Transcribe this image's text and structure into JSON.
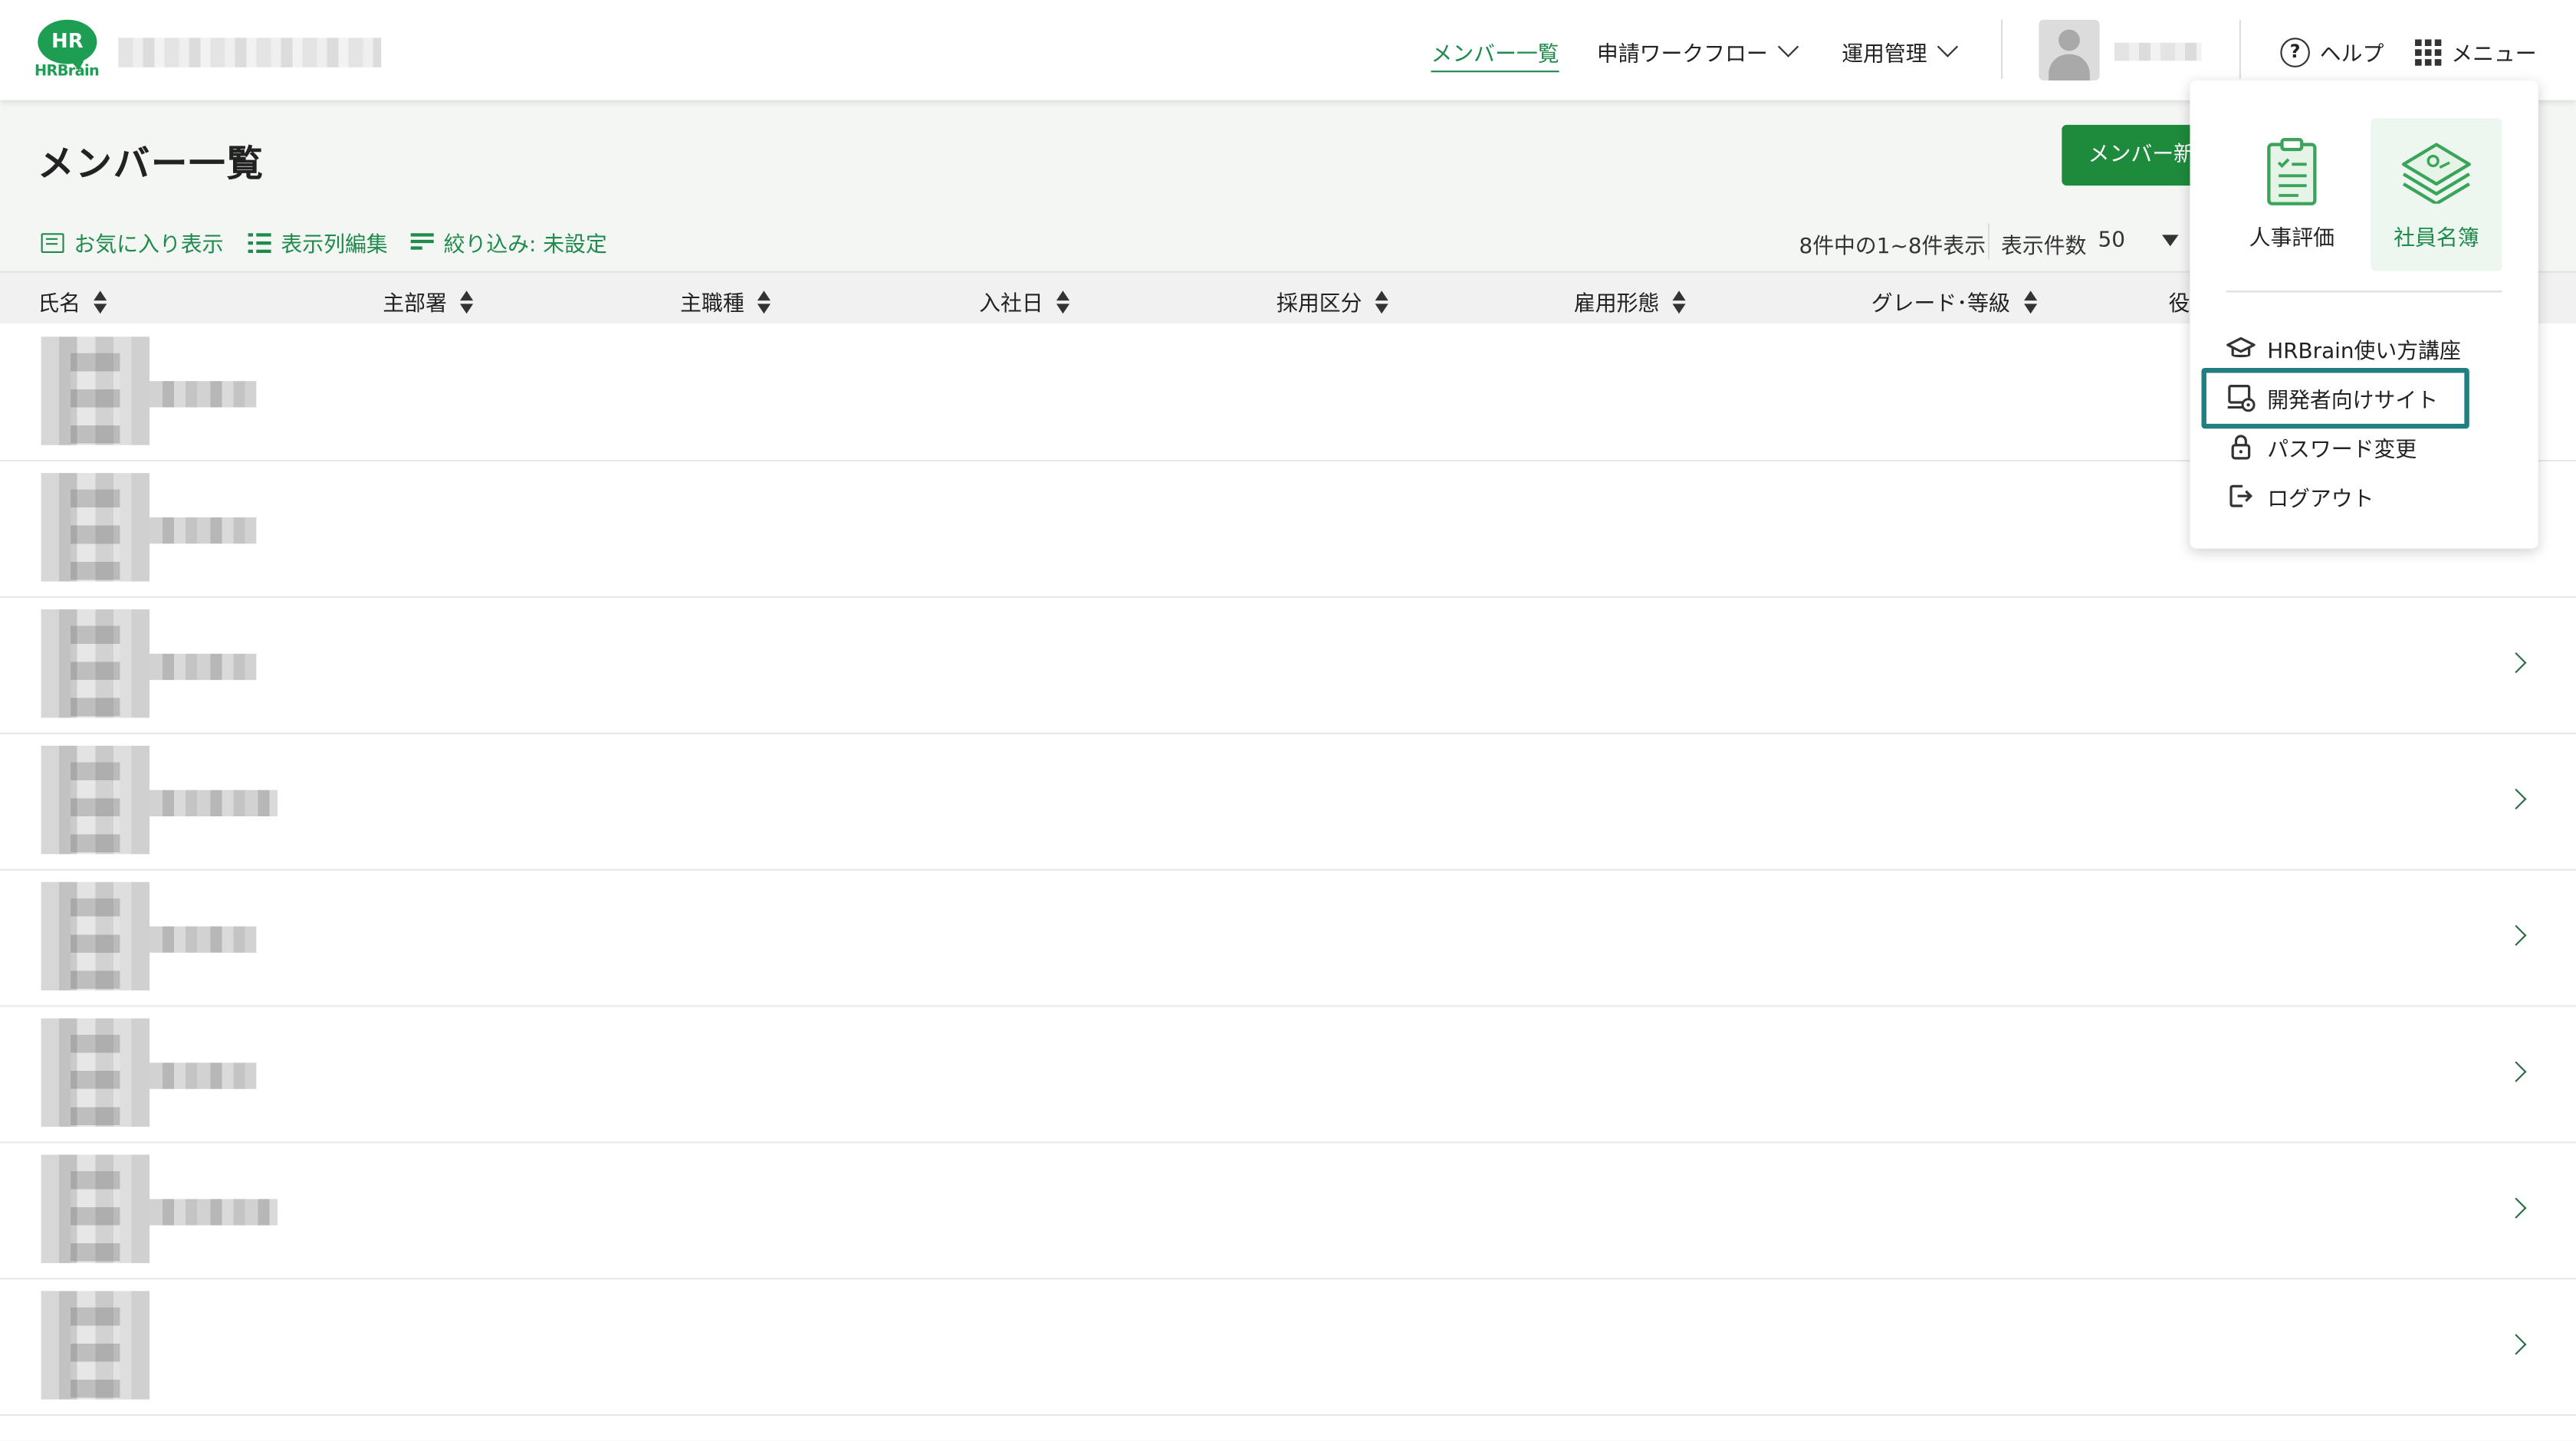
{
  "app": {
    "logo_mark": "HR",
    "logo_word": "HRBrain",
    "brand_color": "#1e9e52"
  },
  "nav": {
    "member_list": "メンバー一覧",
    "workflow": "申請ワークフロー",
    "operations": "運用管理",
    "help": "ヘルプ",
    "menu": "メニュー"
  },
  "page": {
    "title": "メンバー一覧",
    "new_member_button": "メンバー新",
    "favorites": "お気に入り表示",
    "edit_columns": "表示列編集",
    "filter": "絞り込み: 未設定",
    "count_text": "8件中の1~8件表示",
    "per_page_label": "表示件数",
    "per_page_value": "50"
  },
  "table": {
    "columns": [
      "氏名",
      "主部署",
      "主職種",
      "入社日",
      "採用区分",
      "雇用形態",
      "グレード･等級",
      "役"
    ],
    "rows": [
      {
        "name_blur_w": 65,
        "chevron": false
      },
      {
        "name_blur_w": 65,
        "chevron": false
      },
      {
        "name_blur_w": 65,
        "chevron": true
      },
      {
        "name_blur_w": 78,
        "chevron": true
      },
      {
        "name_blur_w": 65,
        "chevron": true
      },
      {
        "name_blur_w": 65,
        "chevron": true
      },
      {
        "name_blur_w": 78,
        "chevron": true
      },
      {
        "name_blur_w": 0,
        "chevron": true
      }
    ]
  },
  "menu_panel": {
    "apps": [
      {
        "label": "人事評価",
        "icon": "clipboard-checklist-icon",
        "selected": false
      },
      {
        "label": "社員名簿",
        "icon": "stacked-cards-icon",
        "selected": true
      }
    ],
    "items": [
      {
        "label": "HRBrain使い方講座",
        "icon": "graduation-cap-icon"
      },
      {
        "label": "開発者向けサイト",
        "icon": "developer-site-icon",
        "highlighted": true
      },
      {
        "label": "パスワード変更",
        "icon": "lock-icon"
      },
      {
        "label": "ログアウト",
        "icon": "logout-icon"
      }
    ]
  }
}
